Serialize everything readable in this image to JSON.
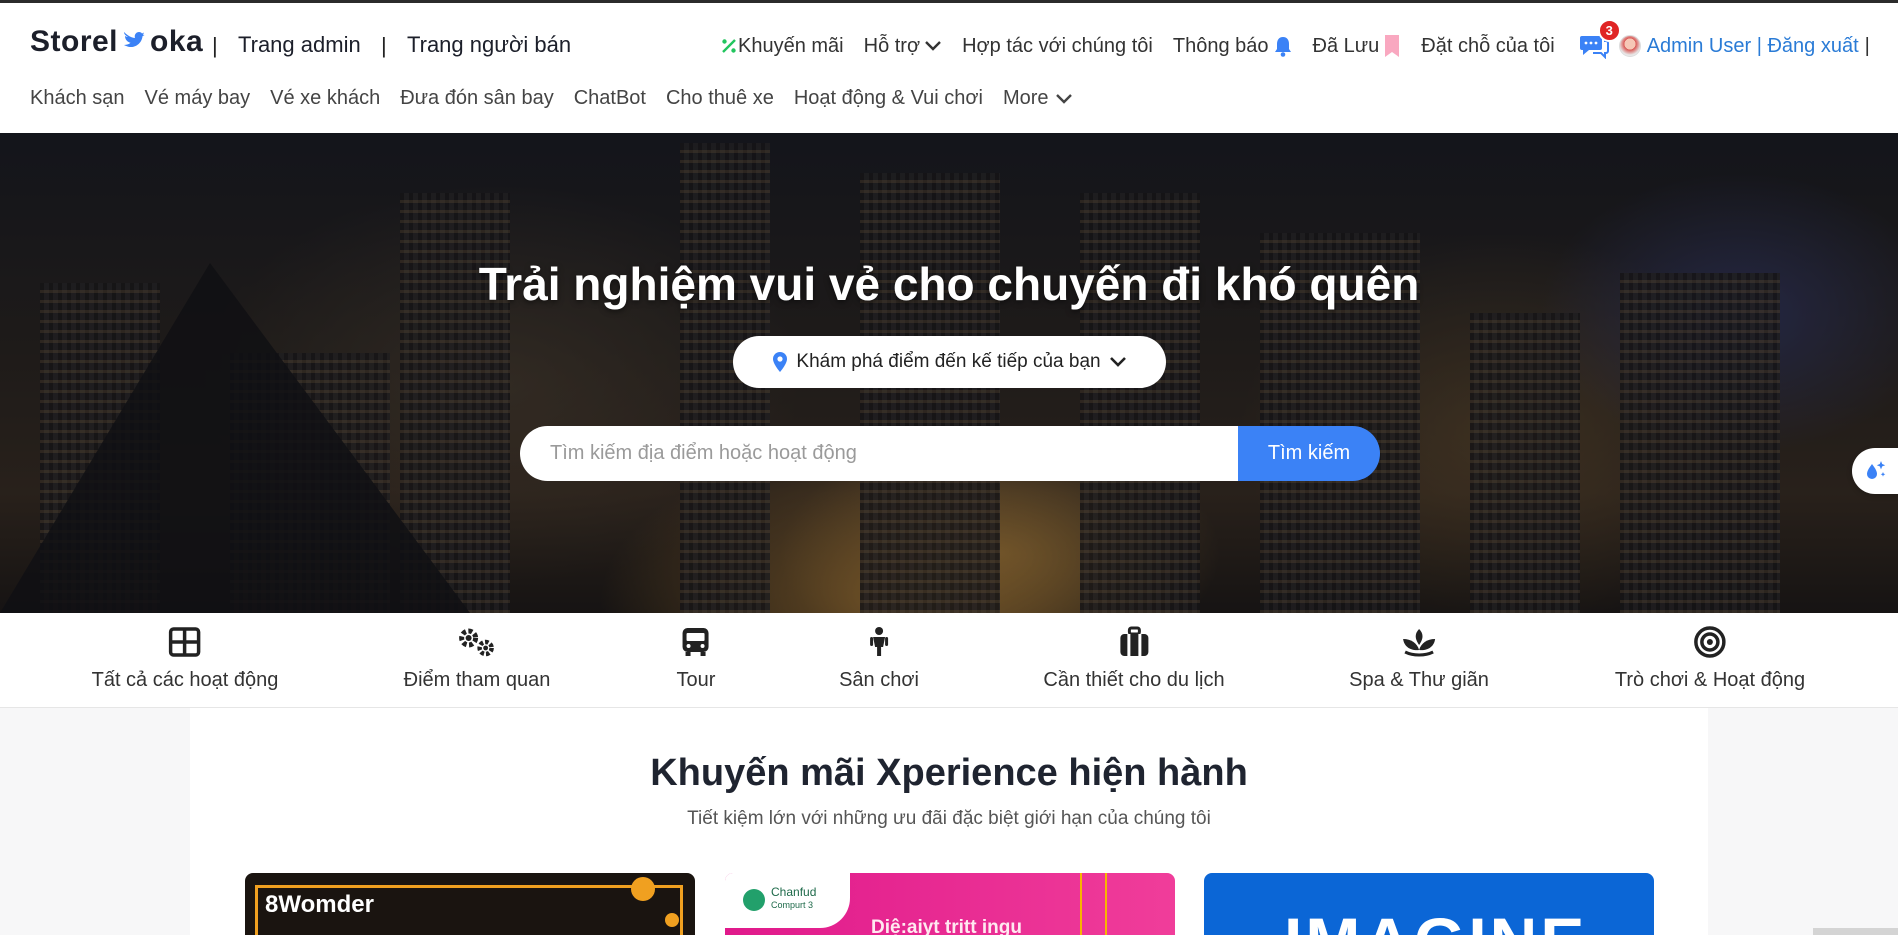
{
  "header": {
    "logo_left": "Storel",
    "logo_right": "oka",
    "separator": "|",
    "admin_link": "Trang admin",
    "seller_link": "Trang người bán",
    "promotions": "Khuyến mãi",
    "support": "Hỗ trợ",
    "partner": "Hợp tác với chúng tôi",
    "notifications": "Thông báo",
    "saved": "Đã Lưu",
    "my_bookings": "Đặt chỗ của tôi",
    "chat_badge": "3",
    "user": "Admin User | Đăng xuất",
    "trailing_sep": "|"
  },
  "nav": {
    "items": [
      "Khách sạn",
      "Vé máy bay",
      "Vé xe khách",
      "Đưa đón sân bay",
      "ChatBot",
      "Cho thuê xe",
      "Hoạt động & Vui chơi"
    ],
    "more": "More"
  },
  "hero": {
    "title": "Trải nghiệm vui vẻ cho chuyến đi khó quên",
    "destination": "Khám phá điểm đến kế tiếp của bạn",
    "search_placeholder": "Tìm kiếm địa điểm hoặc hoạt động",
    "search_button": "Tìm kiếm"
  },
  "categories": [
    {
      "label": "Tất cả các hoạt động",
      "icon": "grid-icon"
    },
    {
      "label": "Điểm tham quan",
      "icon": "gears-icon"
    },
    {
      "label": "Tour",
      "icon": "bus-icon"
    },
    {
      "label": "Sân chơi",
      "icon": "child-icon"
    },
    {
      "label": "Cần thiết cho du lịch",
      "icon": "suitcase-icon"
    },
    {
      "label": "Spa & Thư giãn",
      "icon": "spa-icon"
    },
    {
      "label": "Trò chơi & Hoạt động",
      "icon": "target-icon"
    }
  ],
  "promo": {
    "title": "Khuyến mãi Xperience hiện hành",
    "subtitle": "Tiết kiệm lớn với những ưu đãi đặc biệt giới hạn của chúng tôi",
    "card1_brand": "8Womder",
    "card2_brand": "Chanfud",
    "card2_sub": "Compurt 3",
    "card2_text": "Diệ:aiyt tritt ingu",
    "card3_text": "IMAGINE"
  },
  "colors": {
    "accent": "#3b82f6",
    "badge": "#e02424",
    "user_link": "#2a7bd6",
    "promo_icon": "#22c55e",
    "saved_icon": "#f9a8c0"
  }
}
